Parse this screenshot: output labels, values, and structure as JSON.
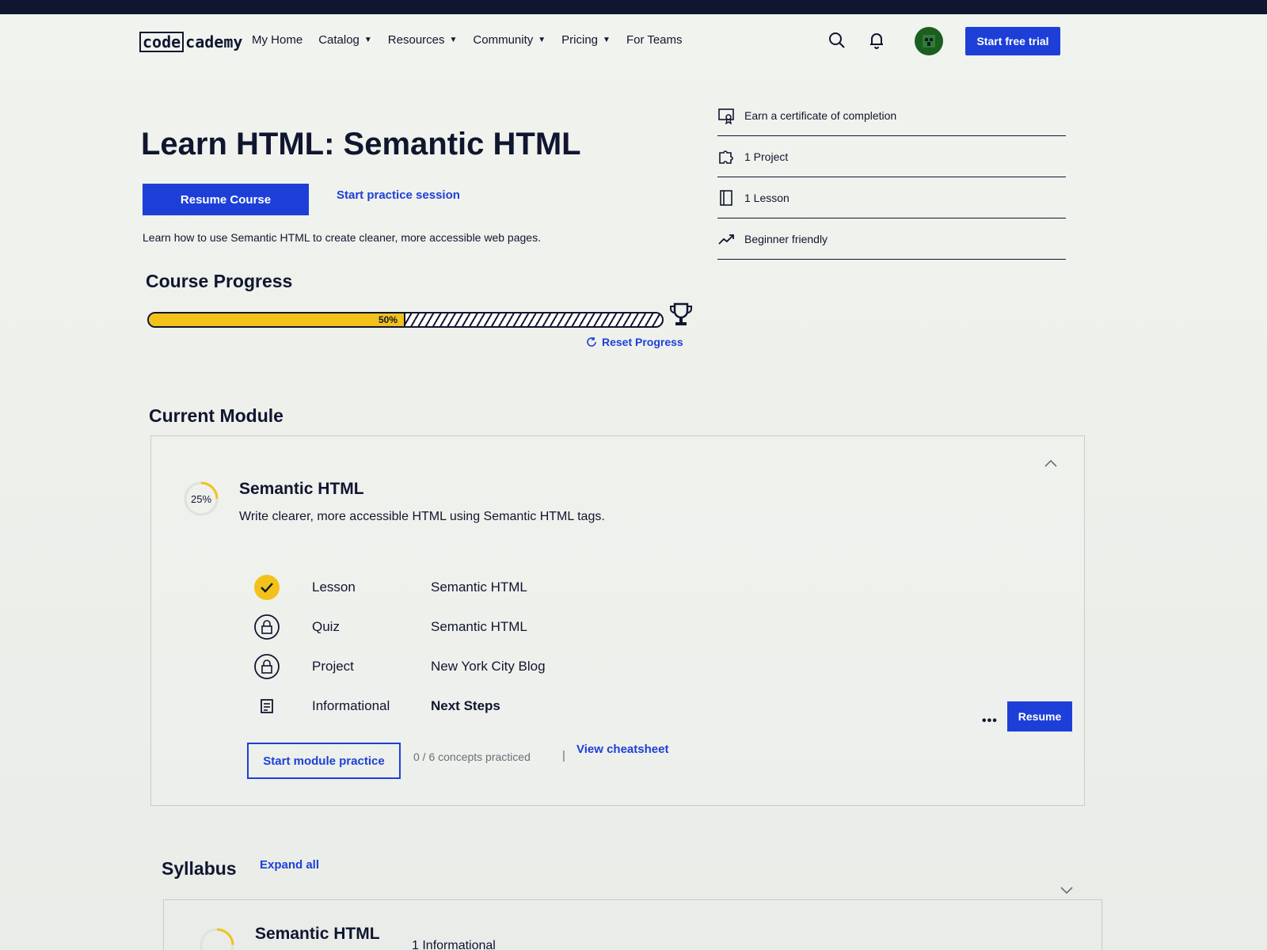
{
  "header": {
    "logo_box": "code",
    "logo_rest": "cademy",
    "nav": [
      {
        "label": "My Home",
        "has_caret": false
      },
      {
        "label": "Catalog",
        "has_caret": true
      },
      {
        "label": "Resources",
        "has_caret": true
      },
      {
        "label": "Community",
        "has_caret": true
      },
      {
        "label": "Pricing",
        "has_caret": true
      },
      {
        "label": "For Teams",
        "has_caret": false
      }
    ],
    "cta_label": "Start free trial",
    "icons": [
      "search-icon",
      "bell-icon",
      "avatar"
    ]
  },
  "course": {
    "title": "Learn HTML: Semantic HTML",
    "resume_label": "Resume Course",
    "practice_label": "Start practice session",
    "description": "Learn how to use Semantic HTML to create cleaner, more accessible web pages.",
    "progress_heading": "Course Progress",
    "progress_percent": 50,
    "progress_label": "50%",
    "reset_label": "Reset Progress"
  },
  "info_list": [
    {
      "icon": "certificate-icon",
      "text": "Earn a certificate of completion"
    },
    {
      "icon": "puzzle-icon",
      "text": "1 Project"
    },
    {
      "icon": "book-icon",
      "text": "1 Lesson"
    },
    {
      "icon": "trend-up-icon",
      "text": "Beginner friendly"
    }
  ],
  "current_module": {
    "heading": "Current Module",
    "percent": 25,
    "percent_label": "25%",
    "title": "Semantic HTML",
    "description": "Write clearer, more accessible HTML using Semantic HTML tags.",
    "items": [
      {
        "icon": "check-icon",
        "type": "Lesson",
        "name": "Semantic HTML",
        "status": "complete"
      },
      {
        "icon": "lock-icon",
        "type": "Quiz",
        "name": "Semantic HTML",
        "status": "locked"
      },
      {
        "icon": "lock-icon",
        "type": "Project",
        "name": "New York City Blog",
        "status": "locked"
      },
      {
        "icon": "article-icon",
        "type": "Informational",
        "name": "Next Steps",
        "status": "current"
      }
    ],
    "more_label": "•••",
    "resume_label": "Resume",
    "practice_label": "Start module practice",
    "concepts_label": "0 / 6 concepts practiced",
    "separator": "|",
    "cheatsheet_label": "View cheatsheet"
  },
  "syllabus": {
    "heading": "Syllabus",
    "expand_label": "Expand all",
    "module_title": "Semantic HTML",
    "module_percent_label": "25%",
    "partial_text": "1 Informational"
  },
  "colors": {
    "brand_blue": "#1d3fd8",
    "navy": "#10162f",
    "progress_yellow": "#f2c21b"
  }
}
